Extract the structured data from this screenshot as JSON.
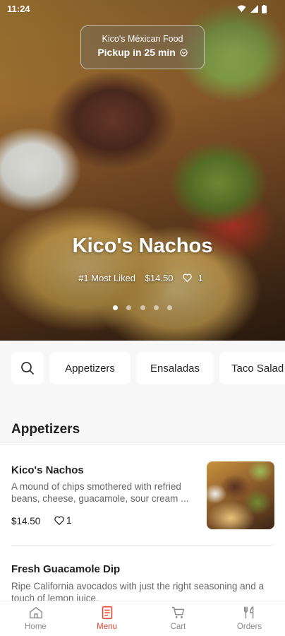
{
  "status_bar": {
    "time": "11:24",
    "icons": [
      "wifi-icon",
      "signal-icon",
      "battery-icon"
    ]
  },
  "store": {
    "name": "Kico's Méxican Food",
    "pickup": "Pickup in 25 min"
  },
  "featured": {
    "title": "Kico's Nachos",
    "badge": "#1 Most Liked",
    "price": "$14.50",
    "likes": "1",
    "carousel": {
      "count": 5,
      "active_index": 1
    }
  },
  "categories": [
    "Appetizers",
    "Ensaladas",
    "Taco Salad"
  ],
  "section": {
    "title": "Appetizers",
    "items": [
      {
        "name": "Kico's Nachos",
        "description": "A mound of chips smothered with refried beans, cheese, guacamole, sour cream ...",
        "price": "$14.50",
        "likes": "1"
      },
      {
        "name": "Fresh Guacamole Dip",
        "description": "Ripe California avocados with just the right seasoning and a touch of lemon juice."
      }
    ]
  },
  "nav": [
    {
      "label": "Home",
      "icon": "home-icon"
    },
    {
      "label": "Menu",
      "icon": "menu-book-icon",
      "active": true
    },
    {
      "label": "Cart",
      "icon": "cart-icon"
    },
    {
      "label": "Orders",
      "icon": "utensils-icon"
    }
  ],
  "colors": {
    "accent": "#e8412c",
    "inactive": "#8a8a8a",
    "background": "#f7f7f7"
  }
}
